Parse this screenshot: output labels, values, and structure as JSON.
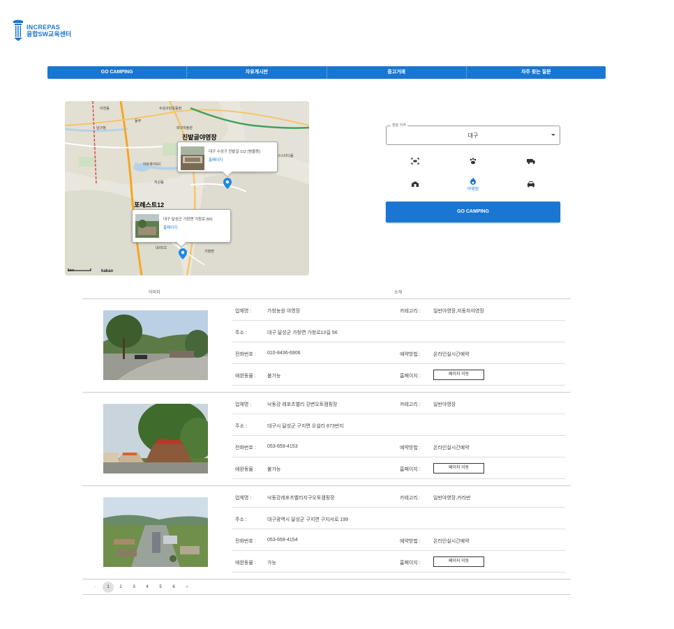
{
  "brand": {
    "name": "INCREPAS",
    "subtitle": "융합SW교육센터"
  },
  "nav": [
    "GO CAMPING",
    "자유게시판",
    "중고거래",
    "자주 찾는 질문"
  ],
  "map": {
    "popups": [
      {
        "title": "진밭골야영장",
        "address": "대구 수성구 진밭길 112 (범물동)",
        "link": "홈페이지"
      },
      {
        "title": "포레스트12",
        "address": "대구 달성군 가창면 가창로 891",
        "link": "홈페이지"
      }
    ],
    "labels": [
      "이천동",
      "남구청",
      "동부",
      "지산동",
      "수성구민운동장",
      "대구미술관",
      "대구스타디움",
      "아트파이GC",
      "내리CC",
      "가창면"
    ],
    "scale": "1km",
    "provider": "kakao"
  },
  "filter": {
    "region_label": "캠핑 지역",
    "region_value": "대구",
    "icons": [
      {
        "name": "glamping-icon",
        "label": ""
      },
      {
        "name": "pet-icon",
        "label": ""
      },
      {
        "name": "caravan-icon",
        "label": ""
      },
      {
        "name": "tent-icon",
        "label": ""
      },
      {
        "name": "fire-icon",
        "label": "야영장"
      },
      {
        "name": "car-icon",
        "label": ""
      }
    ],
    "go_label": "GO CAMPING"
  },
  "table": {
    "col_image": "이미지",
    "col_intro": "소개",
    "keys": {
      "name": "업체명 :",
      "name_alt": "업체명 :",
      "category": "카테고리 :",
      "address": "주소 :",
      "phone": "전화번호 :",
      "reserve": "예약방법 :",
      "pet": "애완동물 :",
      "homepage": "홈페이지 :"
    },
    "button_label": "페이지 이동",
    "rows": [
      {
        "name": "가창농원 야영장",
        "category": "일반야영장,자동차야영장",
        "address": "대구 달성군 가창면 가창로10길 56",
        "phone": "010-8436-6906",
        "reserve": "온라인실시간예약",
        "pet": "불가능"
      },
      {
        "name": "낙동강 레포츠밸리 강변오토캠핑장",
        "category": "일반야영장",
        "address": "대구시 달성군 구지면 오설리 873번지",
        "phone": "053-659-4153",
        "reserve": "온라인실시간예약",
        "pet": "불가능"
      },
      {
        "name": "낙동강레포츠밸리지구오토캠핑장",
        "category": "일반야영장,카라반",
        "address": "대구광역시 달성군 구지면 구지서로 199",
        "phone": "053-659-4154",
        "reserve": "온라인실시간예약",
        "pet": "가능"
      }
    ]
  },
  "pagination": {
    "prev": "‹",
    "pages": [
      "1",
      "2",
      "3",
      "4",
      "5",
      "6"
    ],
    "next": "›",
    "current": "1"
  }
}
